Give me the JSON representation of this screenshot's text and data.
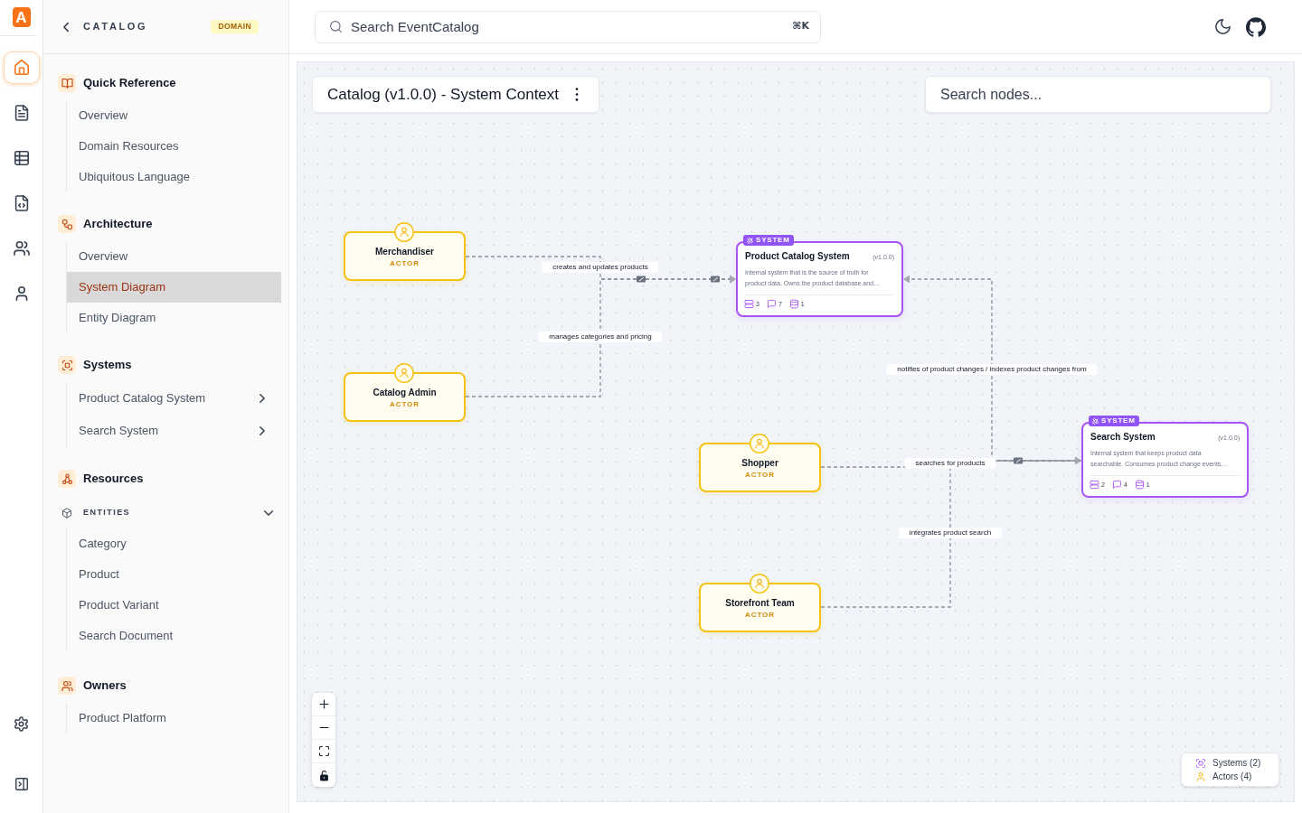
{
  "rail": {
    "logo": "A",
    "items": [
      {
        "kind": "home",
        "selected": true
      },
      {
        "kind": "docs",
        "selected": false
      },
      {
        "kind": "table",
        "selected": false
      },
      {
        "kind": "code",
        "selected": false
      },
      {
        "kind": "teams",
        "selected": false
      },
      {
        "kind": "user",
        "selected": false
      }
    ]
  },
  "sidebar": {
    "title": "CATALOG",
    "badge": "DOMAIN",
    "sections": [
      {
        "kind": "quick_reference",
        "title": "Quick Reference",
        "items": [
          {
            "label": "Overview",
            "selected": false
          },
          {
            "label": "Domain Resources",
            "selected": false
          },
          {
            "label": "Ubiquitous Language",
            "selected": false
          }
        ]
      },
      {
        "kind": "architecture",
        "title": "Architecture",
        "items": [
          {
            "label": "Overview",
            "selected": false
          },
          {
            "label": "System Diagram",
            "selected": true
          },
          {
            "label": "Entity Diagram",
            "selected": false
          }
        ]
      },
      {
        "kind": "systems",
        "title": "Systems",
        "items": [
          {
            "label": "Product Catalog System",
            "selected": false,
            "expanded": false
          },
          {
            "label": "Search System",
            "selected": false,
            "expanded": false
          }
        ]
      },
      {
        "kind": "resources",
        "title": "Resources",
        "groups": [
          {
            "title": "ENTITIES",
            "expanded": true,
            "items": [
              {
                "label": "Category",
                "selected": false
              },
              {
                "label": "Product",
                "selected": false
              },
              {
                "label": "Product Variant",
                "selected": false
              },
              {
                "label": "Search Document",
                "selected": false
              }
            ]
          }
        ]
      },
      {
        "kind": "owners",
        "title": "Owners",
        "items": [
          {
            "label": "Product Platform",
            "selected": false
          }
        ]
      }
    ]
  },
  "top_bar": {
    "search": {
      "placeholder": "Search EventCatalog",
      "shortcut": "⌘K"
    }
  },
  "diagram": {
    "title": "Catalog (v1.0.0) - System Context",
    "node_search": {
      "placeholder": "Search nodes..."
    },
    "nodes": [
      {
        "kind": "actor",
        "name": "Merchandiser",
        "type_label": "ACTOR"
      },
      {
        "kind": "system",
        "name": "Product Catalog System",
        "type_label": "SYSTEM",
        "version": "(v1.0.0)",
        "description": "Internal system that is the source of truth for product data. Owns the product database and…",
        "stats": [
          {
            "kind": "services",
            "count": "3"
          },
          {
            "kind": "messages",
            "count": "7"
          },
          {
            "kind": "databases",
            "count": "1"
          }
        ]
      },
      {
        "kind": "actor",
        "name": "Catalog Admin",
        "type_label": "ACTOR"
      },
      {
        "kind": "system",
        "name": "Search System",
        "type_label": "SYSTEM",
        "version": "(v1.0.0)",
        "description": "Internal system that keeps product data searchable. Consumes product change events…",
        "stats": [
          {
            "kind": "services",
            "count": "2"
          },
          {
            "kind": "messages",
            "count": "4"
          },
          {
            "kind": "databases",
            "count": "1"
          }
        ]
      },
      {
        "kind": "actor",
        "name": "Shopper",
        "type_label": "ACTOR"
      },
      {
        "kind": "actor",
        "name": "Storefront Team",
        "type_label": "ACTOR"
      }
    ],
    "edges": [
      {
        "label": "creates and updates products"
      },
      {
        "label": "manages categories and pricing"
      },
      {
        "label": "notifies of product changes / indexes product changes from"
      },
      {
        "label": "searches for products"
      },
      {
        "label": "integrates product search"
      }
    ],
    "legend": [
      {
        "kind": "system",
        "label": "Systems (2)"
      },
      {
        "kind": "actor",
        "label": "Actors (4)"
      }
    ]
  }
}
